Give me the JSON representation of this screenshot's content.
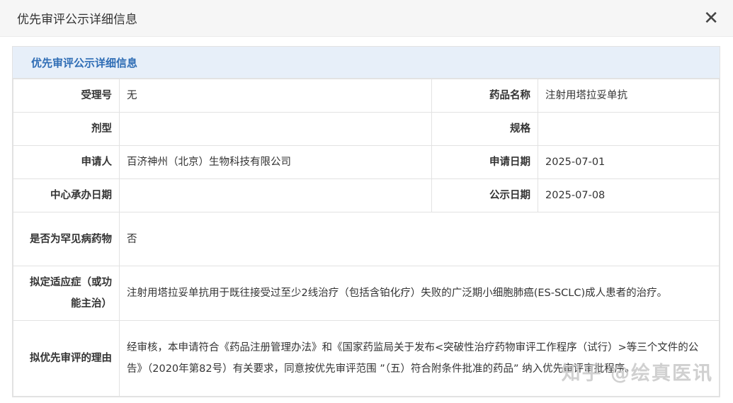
{
  "dialog": {
    "title": "优先审评公示详细信息",
    "close_icon": "close-icon"
  },
  "section": {
    "title": "优先审评公示详细信息"
  },
  "fields": {
    "accept_no": {
      "label": "受理号",
      "value": "无"
    },
    "drug_name": {
      "label": "药品名称",
      "value": "注射用塔拉妥单抗"
    },
    "dosage_form": {
      "label": "剂型",
      "value": ""
    },
    "spec": {
      "label": "规格",
      "value": ""
    },
    "applicant": {
      "label": "申请人",
      "value": "百济神州（北京）生物科技有限公司"
    },
    "apply_date": {
      "label": "申请日期",
      "value": "2025-07-01"
    },
    "center_date": {
      "label": "中心承办日期",
      "value": ""
    },
    "publish_date": {
      "label": "公示日期",
      "value": "2025-07-08"
    },
    "rare_disease": {
      "label": "是否为罕见病药物",
      "value": "否"
    },
    "indication": {
      "label": "拟定适应症（或功能主治）",
      "value": "注射用塔拉妥单抗用于既往接受过至少2线治疗（包括含铂化疗）失败的广泛期小细胞肺癌(ES-SCLC)成人患者的治疗。"
    },
    "reason": {
      "label": "拟优先审评的理由",
      "value": "经审核，本申请符合《药品注册管理办法》和《国家药监局关于发布<突破性治疗药物审评工作程序（试行）>等三个文件的公告》（2020年第82号）有关要求，同意按优先审评范围 ”（五）符合附条件批准的药品” 纳入优先审评审批程序。"
    }
  },
  "watermark": "知乎 @绘真医讯"
}
